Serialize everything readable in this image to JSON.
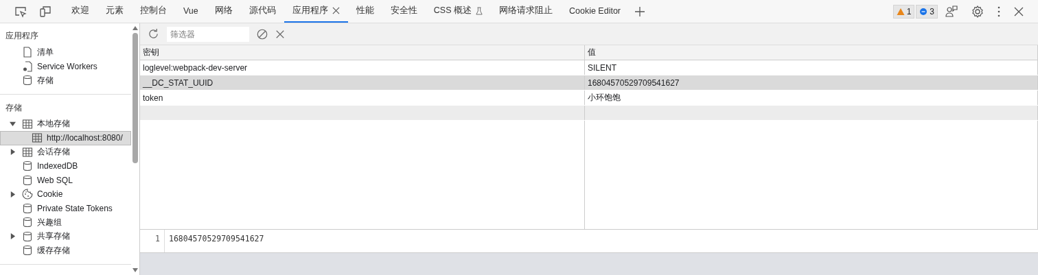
{
  "tabs": [
    {
      "label": "欢迎",
      "selected": false,
      "closable": false,
      "experimental": false
    },
    {
      "label": "元素",
      "selected": false,
      "closable": false,
      "experimental": false
    },
    {
      "label": "控制台",
      "selected": false,
      "closable": false,
      "experimental": false
    },
    {
      "label": "Vue",
      "selected": false,
      "closable": false,
      "experimental": false
    },
    {
      "label": "网络",
      "selected": false,
      "closable": false,
      "experimental": false
    },
    {
      "label": "源代码",
      "selected": false,
      "closable": false,
      "experimental": false
    },
    {
      "label": "应用程序",
      "selected": true,
      "closable": true,
      "experimental": false
    },
    {
      "label": "性能",
      "selected": false,
      "closable": false,
      "experimental": false
    },
    {
      "label": "安全性",
      "selected": false,
      "closable": false,
      "experimental": false
    },
    {
      "label": "CSS 概述",
      "selected": false,
      "closable": false,
      "experimental": true
    },
    {
      "label": "网络请求阻止",
      "selected": false,
      "closable": false,
      "experimental": false
    },
    {
      "label": "Cookie Editor",
      "selected": false,
      "closable": false,
      "experimental": false
    }
  ],
  "issues": {
    "warnings": "1",
    "messages": "3"
  },
  "sidebar": {
    "sections": [
      {
        "title": "应用程序",
        "items": [
          {
            "label": "清单",
            "kind": "file",
            "selected": false
          },
          {
            "label": "Service Workers",
            "kind": "gearfile",
            "selected": false
          },
          {
            "label": "存储",
            "kind": "db",
            "selected": false
          }
        ]
      },
      {
        "title": "存储",
        "items": [
          {
            "label": "本地存储",
            "kind": "grid",
            "selected": false,
            "expanded": true,
            "children": [
              {
                "label": "http://localhost:8080/",
                "kind": "grid",
                "selected": true
              }
            ]
          },
          {
            "label": "会话存储",
            "kind": "grid",
            "selected": false,
            "expanded": false
          },
          {
            "label": "IndexedDB",
            "kind": "db",
            "selected": false
          },
          {
            "label": "Web SQL",
            "kind": "db",
            "selected": false
          },
          {
            "label": "Cookie",
            "kind": "cookie",
            "selected": false,
            "expanded": false
          },
          {
            "label": "Private State Tokens",
            "kind": "db",
            "selected": false
          },
          {
            "label": "兴趣组",
            "kind": "db",
            "selected": false
          },
          {
            "label": "共享存储",
            "kind": "db",
            "selected": false,
            "expanded": false
          },
          {
            "label": "缓存存储",
            "kind": "db",
            "selected": false
          }
        ]
      }
    ]
  },
  "toolbar": {
    "filter": {
      "placeholder": "筛选器"
    }
  },
  "table": {
    "columns": [
      "密钥",
      "值"
    ],
    "rows": [
      {
        "key": "loglevel:webpack-dev-server",
        "value": "SILENT",
        "selected": false
      },
      {
        "key": "__DC_STAT_UUID",
        "value": "16804570529709541627",
        "selected": true
      },
      {
        "key": "token",
        "value": "小环饱饱",
        "selected": false
      }
    ]
  },
  "preview": {
    "line_number": "1",
    "text": "16804570529709541627"
  }
}
